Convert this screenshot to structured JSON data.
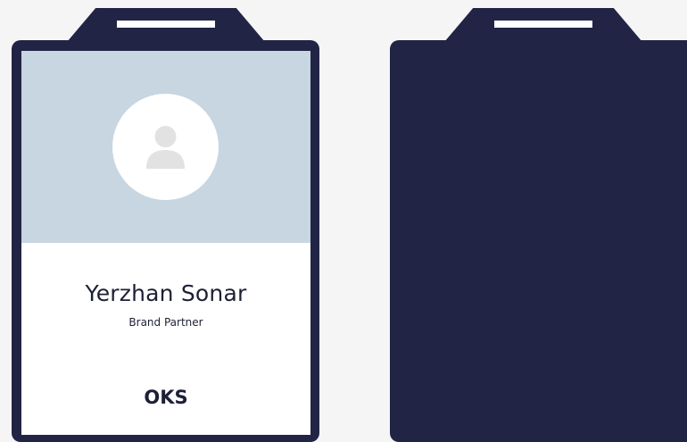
{
  "front_badge": {
    "name": "Yerzhan Sonar",
    "role": "Brand Partner",
    "company": "OKS",
    "avatar_icon": "user-placeholder-icon"
  },
  "back_badge": {},
  "colors": {
    "background": "#f5f5f6",
    "badge_frame": "#222445",
    "photo_area": "#c7d6e0",
    "avatar_circle": "#ffffff",
    "avatar_silhouette": "#e2e2e2",
    "text": "#1d2035"
  }
}
